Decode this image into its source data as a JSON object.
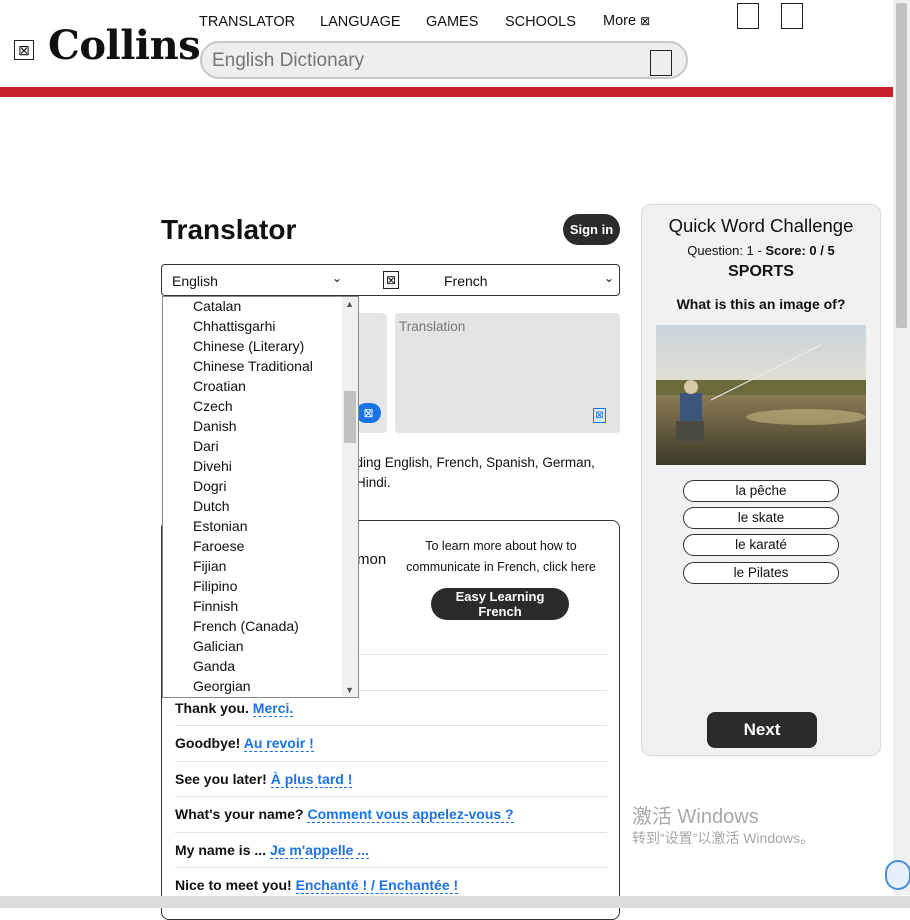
{
  "header": {
    "logo_text": "Collins",
    "nav": [
      "TRANSLATOR",
      "LANGUAGE",
      "GAMES",
      "SCHOOLS",
      "More"
    ],
    "search_placeholder": "English Dictionary"
  },
  "translator": {
    "title": "Translator",
    "signin": "Sign in",
    "from_lang": "English",
    "to_lang": "French",
    "translation_placeholder": "Translation",
    "description_line1": "uding English, French, Spanish, German,",
    "description_line2": "Hindi."
  },
  "dropdown": {
    "options": [
      "Catalan",
      "Chhattisgarhi",
      "Chinese (Literary)",
      "Chinese Traditional",
      "Croatian",
      "Czech",
      "Danish",
      "Dari",
      "Divehi",
      "Dogri",
      "Dutch",
      "Estonian",
      "Faroese",
      "Fijian",
      "Filipino",
      "Finnish",
      "French (Canada)",
      "Galician",
      "Ganda",
      "Georgian"
    ]
  },
  "phrases_box": {
    "common_fragment": "mon",
    "learn_text": "To learn more about how to communicate in French, click here",
    "easy_button": "Easy Learning French",
    "rows": [
      {
        "en": "Thank you.",
        "fr": "Merci."
      },
      {
        "en": "Goodbye!",
        "fr": "Au revoir !"
      },
      {
        "en": "See you later!",
        "fr": "À plus tard !"
      },
      {
        "en": "What's your name?",
        "fr": "Comment vous appelez-vous ?"
      },
      {
        "en": "My name is ...",
        "fr": "Je m'appelle ..."
      },
      {
        "en": "Nice to meet you!",
        "fr": "Enchanté ! / Enchantée !"
      }
    ]
  },
  "quiz": {
    "title": "Quick Word Challenge",
    "question_label": "Question: 1",
    "score_label": "Score: 0 / 5",
    "category": "SPORTS",
    "prompt": "What is this an image of?",
    "options": [
      "la pêche",
      "le skate",
      "le karaté",
      "le Pilates"
    ],
    "next": "Next"
  },
  "watermark": {
    "line1": "激活 Windows",
    "line2": "转到“设置”以激活 Windows。"
  },
  "colors": {
    "brand_red": "#c8202a",
    "link_blue": "#1a73e8",
    "dark_button": "#2b2b2b"
  }
}
